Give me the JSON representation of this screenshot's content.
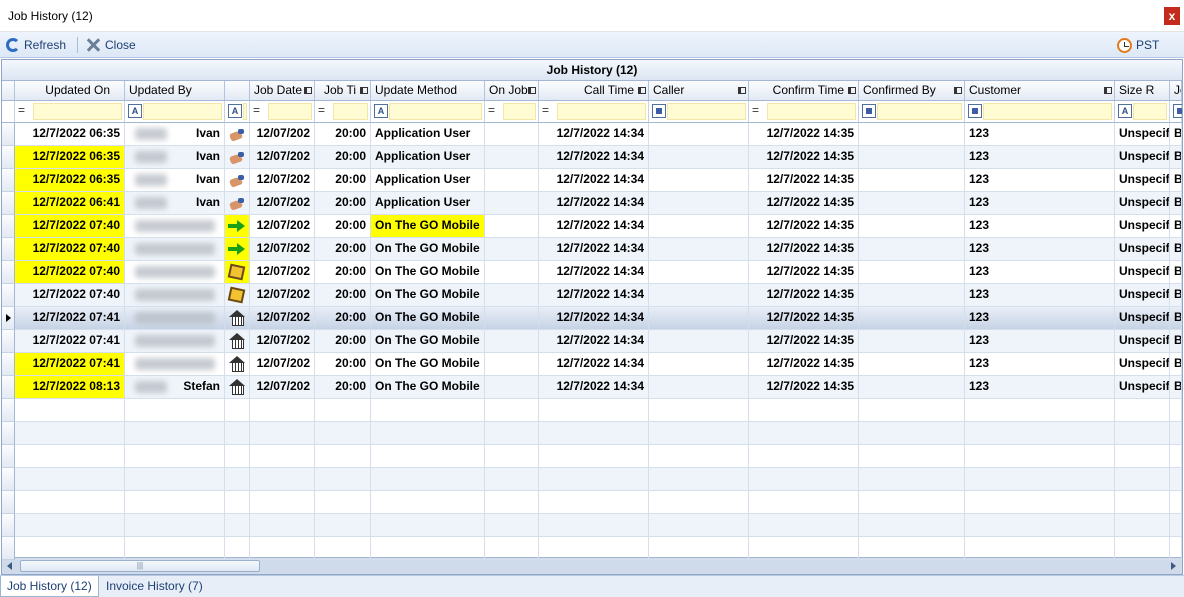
{
  "window": {
    "title": "Job History (12)",
    "close_label": "x"
  },
  "toolbar": {
    "refresh_label": "Refresh",
    "close_label": "Close",
    "timezone_label": "PST"
  },
  "grid": {
    "band_title": "Job History (12)",
    "columns": [
      {
        "label": "",
        "align": "left"
      },
      {
        "label": "Updated On",
        "align": "right"
      },
      {
        "label": "Updated By",
        "align": "left"
      },
      {
        "label": "",
        "align": "left"
      },
      {
        "label": "Job Date",
        "align": "right"
      },
      {
        "label": "Job Ti",
        "align": "right"
      },
      {
        "label": "Update Method",
        "align": "left"
      },
      {
        "label": "On Job",
        "align": "left"
      },
      {
        "label": "Call Time",
        "align": "right"
      },
      {
        "label": "Caller",
        "align": "left"
      },
      {
        "label": "Confirm Time",
        "align": "right"
      },
      {
        "label": "Confirmed By",
        "align": "left"
      },
      {
        "label": "Customer",
        "align": "left"
      },
      {
        "label": "Size R",
        "align": "left"
      },
      {
        "label": "Jo",
        "align": "left"
      }
    ],
    "rows": [
      {
        "updated_on": "12/7/2022 06:35",
        "updated_by": "Ivan",
        "icon": "hand-icon",
        "job_date": "12/07/202",
        "job_time": "20:00",
        "update_method": "Application User",
        "call_time": "12/7/2022 14:34",
        "confirm_time": "12/7/2022 14:35",
        "customer": "123",
        "size": "Unspecif",
        "jo": "B",
        "hl_updated": false,
        "hl_method": false
      },
      {
        "updated_on": "12/7/2022 06:35",
        "updated_by": "Ivan",
        "icon": "hand-icon",
        "job_date": "12/07/202",
        "job_time": "20:00",
        "update_method": "Application User",
        "call_time": "12/7/2022 14:34",
        "confirm_time": "12/7/2022 14:35",
        "customer": "123",
        "size": "Unspecif",
        "jo": "B",
        "hl_updated": true,
        "hl_method": false
      },
      {
        "updated_on": "12/7/2022 06:35",
        "updated_by": "Ivan",
        "icon": "hand-icon",
        "job_date": "12/07/202",
        "job_time": "20:00",
        "update_method": "Application User",
        "call_time": "12/7/2022 14:34",
        "confirm_time": "12/7/2022 14:35",
        "customer": "123",
        "size": "Unspecif",
        "jo": "B",
        "hl_updated": true,
        "hl_method": false
      },
      {
        "updated_on": "12/7/2022 06:41",
        "updated_by": "Ivan",
        "icon": "hand-icon",
        "job_date": "12/07/202",
        "job_time": "20:00",
        "update_method": "Application User",
        "call_time": "12/7/2022 14:34",
        "confirm_time": "12/7/2022 14:35",
        "customer": "123",
        "size": "Unspecif",
        "jo": "B",
        "hl_updated": true,
        "hl_method": false
      },
      {
        "updated_on": "12/7/2022 07:40",
        "updated_by": "",
        "icon": "arrow-right-icon",
        "job_date": "12/07/202",
        "job_time": "20:00",
        "update_method": "On The GO Mobile",
        "call_time": "12/7/2022 14:34",
        "confirm_time": "12/7/2022 14:35",
        "customer": "123",
        "size": "Unspecif",
        "jo": "B",
        "hl_updated": true,
        "hl_method": true
      },
      {
        "updated_on": "12/7/2022 07:40",
        "updated_by": "",
        "icon": "arrow-right-icon",
        "job_date": "12/07/202",
        "job_time": "20:00",
        "update_method": "On The GO Mobile",
        "call_time": "12/7/2022 14:34",
        "confirm_time": "12/7/2022 14:35",
        "customer": "123",
        "size": "Unspecif",
        "jo": "B",
        "hl_updated": true,
        "hl_method": false
      },
      {
        "updated_on": "12/7/2022 07:40",
        "updated_by": "",
        "icon": "star-icon",
        "job_date": "12/07/202",
        "job_time": "20:00",
        "update_method": "On The GO Mobile",
        "call_time": "12/7/2022 14:34",
        "confirm_time": "12/7/2022 14:35",
        "customer": "123",
        "size": "Unspecif",
        "jo": "B",
        "hl_updated": true,
        "hl_method": false
      },
      {
        "updated_on": "12/7/2022 07:40",
        "updated_by": "",
        "icon": "star-icon",
        "job_date": "12/07/202",
        "job_time": "20:00",
        "update_method": "On The GO Mobile",
        "call_time": "12/7/2022 14:34",
        "confirm_time": "12/7/2022 14:35",
        "customer": "123",
        "size": "Unspecif",
        "jo": "B",
        "hl_updated": false,
        "hl_method": false
      },
      {
        "updated_on": "12/7/2022 07:41",
        "updated_by": "",
        "icon": "house-icon",
        "job_date": "12/07/202",
        "job_time": "20:00",
        "update_method": "On The GO Mobile",
        "call_time": "12/7/2022 14:34",
        "confirm_time": "12/7/2022 14:35",
        "customer": "123",
        "size": "Unspecif",
        "jo": "B",
        "hl_updated": false,
        "hl_method": false
      },
      {
        "updated_on": "12/7/2022 07:41",
        "updated_by": "",
        "icon": "house-icon",
        "job_date": "12/07/202",
        "job_time": "20:00",
        "update_method": "On The GO Mobile",
        "call_time": "12/7/2022 14:34",
        "confirm_time": "12/7/2022 14:35",
        "customer": "123",
        "size": "Unspecif",
        "jo": "B",
        "hl_updated": false,
        "hl_method": false
      },
      {
        "updated_on": "12/7/2022 07:41",
        "updated_by": "",
        "icon": "house-icon",
        "job_date": "12/07/202",
        "job_time": "20:00",
        "update_method": "On The GO Mobile",
        "call_time": "12/7/2022 14:34",
        "confirm_time": "12/7/2022 14:35",
        "customer": "123",
        "size": "Unspecif",
        "jo": "B",
        "hl_updated": true,
        "hl_method": false
      },
      {
        "updated_on": "12/7/2022 08:13",
        "updated_by": "Stefan",
        "icon": "house-icon",
        "job_date": "12/07/202",
        "job_time": "20:00",
        "update_method": "On The GO Mobile",
        "call_time": "12/7/2022 14:34",
        "confirm_time": "12/7/2022 14:35",
        "customer": "123",
        "size": "Unspecif",
        "jo": "B",
        "hl_updated": true,
        "hl_method": false
      }
    ],
    "selected_row": 8,
    "highlight_color": "#ffff00"
  },
  "tabs": [
    {
      "label": "Job History (12)",
      "active": true
    },
    {
      "label": "Invoice History (7)",
      "active": false
    }
  ]
}
